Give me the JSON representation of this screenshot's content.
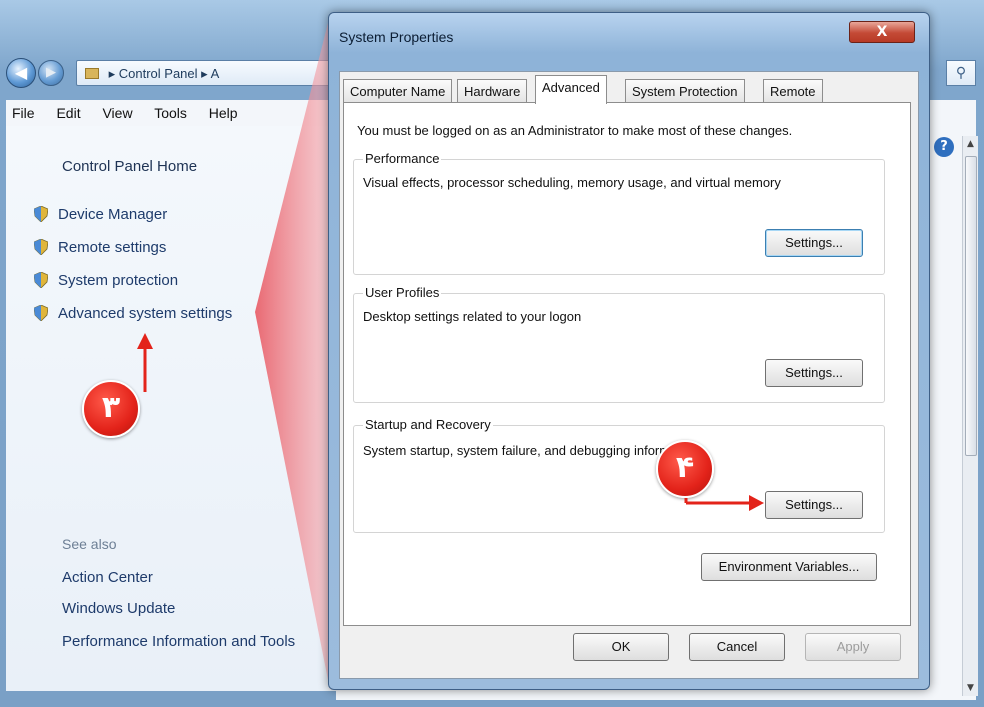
{
  "control_panel": {
    "address": [
      "Control Panel",
      "A"
    ],
    "menu": [
      "File",
      "Edit",
      "View",
      "Tools",
      "Help"
    ],
    "home_link": "Control Panel Home",
    "tasks": [
      "Device Manager",
      "Remote settings",
      "System protection",
      "Advanced system settings"
    ],
    "see_also_label": "See also",
    "see_also": [
      "Action Center",
      "Windows Update",
      "Performance Information and Tools"
    ],
    "close_glyph": "x",
    "help_glyph": "?"
  },
  "dialog": {
    "title": "System Properties",
    "close_glyph": "X",
    "tabs": [
      "Computer Name",
      "Hardware",
      "Advanced",
      "System Protection",
      "Remote"
    ],
    "active_tab": "Advanced",
    "admin_note": "You must be logged on as an Administrator to make most of these changes.",
    "groups": [
      {
        "label": "Performance",
        "description": "Visual effects, processor scheduling, memory usage, and virtual memory",
        "button": "Settings..."
      },
      {
        "label": "User Profiles",
        "description": "Desktop settings related to your logon",
        "button": "Settings..."
      },
      {
        "label": "Startup and Recovery",
        "description": "System startup, system failure, and debugging information",
        "button": "Settings..."
      }
    ],
    "env_button": "Environment Variables...",
    "footer_buttons": {
      "ok": "OK",
      "cancel": "Cancel",
      "apply": "Apply"
    }
  },
  "annotations": {
    "step3": "٣",
    "step4": "۴",
    "accent_color": "#e3231a"
  }
}
